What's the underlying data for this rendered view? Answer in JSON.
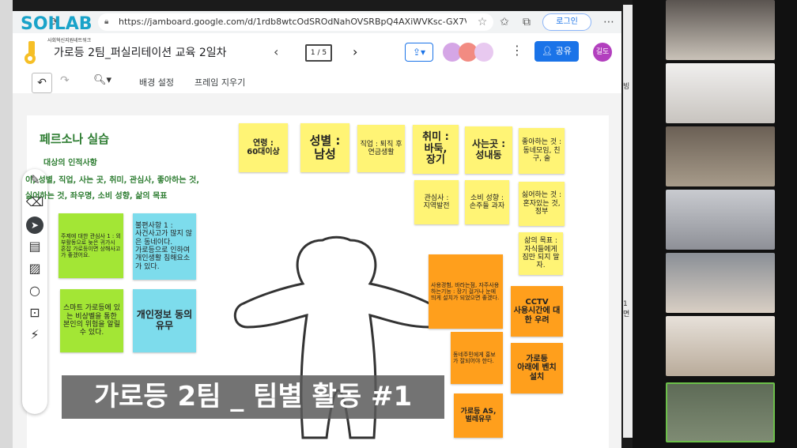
{
  "browser": {
    "url": "https://jamboard.google.com/d/1rdb8wtcOdSROdNahOVSRBpQ4AXiWVKsc-GX7Vndn5U/vi...",
    "login_label": "로그인"
  },
  "logo": {
    "brand": "SOILAB",
    "tagline": "사회혁신지원네트워크"
  },
  "appbar": {
    "title": "가로등 2팀_퍼실리테이션 교육 2일차",
    "frame_counter": "1 / 5",
    "share_label": "공유",
    "avatar_initials": "길도"
  },
  "toolbar": {
    "background_label": "배경 설정",
    "clear_frame_label": "프레임 지우기"
  },
  "persona": {
    "title": "페르소나 실습",
    "subtitle1": "대상의 인적사항",
    "subtitle2": "이, 성별, 직업, 사는 곳, 취미, 관심사, 좋아하는 것,",
    "subtitle3": "싫어하는 것, 좌우명, 소비 성향, 삶의 목표"
  },
  "notes": {
    "age": "연령 :\n60대이상",
    "gender": "성별 :\n남성",
    "job": "직업 : 퇴직 후 연금생활",
    "hobby": "취미 :\n바둑,\n장기",
    "place": "사는곳 :\n성내동",
    "likes": "좋아하는 것 : 동네모임, 친구, 술",
    "interest": "관심사 :\n지역발전",
    "consumption": "소비 성향 :\n손주들 과자",
    "dislikes": "싫어하는 것 : 혼자있는 것, 정부",
    "life_goal": "삶의 목표 :\n자식들에게 짐만 되지 말자.",
    "green1": "주제에 대한 관심사 1 : 외부활동으로 늦은 귀가시 혼잡 가로등이면 상해사고가 좋겠어요.",
    "cyan1": "불편사항 1 :\n사건사고가 많지 않은 동네이다.\n가로등으로 인하여 개인생활 침해요소가 있다.",
    "green2": "스마트 가로등에 있는 비상벨을 통한 본인의 위험을 알릴 수 있다.",
    "cyan2": "개인정보 동의유무",
    "orange1": "사용경험, 바라는점, 자주사용하는기능 : 장기 걸거나 눈에 띄게 설치가 되었으면 좋겠다.",
    "orange2": "CCTV\n사용시간에 대한 우려",
    "orange3": "동네주민에게 홍보가 잘되어야 한다.",
    "orange4": "가로등\n아래에 벤치 설치",
    "orange5": "가로등 AS,\n벌레유무"
  },
  "caption": "가로등 2팀 _ 팀별 활동 #1",
  "side_text": {
    "a": "빙",
    "b": "1면"
  },
  "colors": {
    "accent": "#1a73e8",
    "note_yellow": "#fff475",
    "note_orange": "#ff9f1c"
  }
}
